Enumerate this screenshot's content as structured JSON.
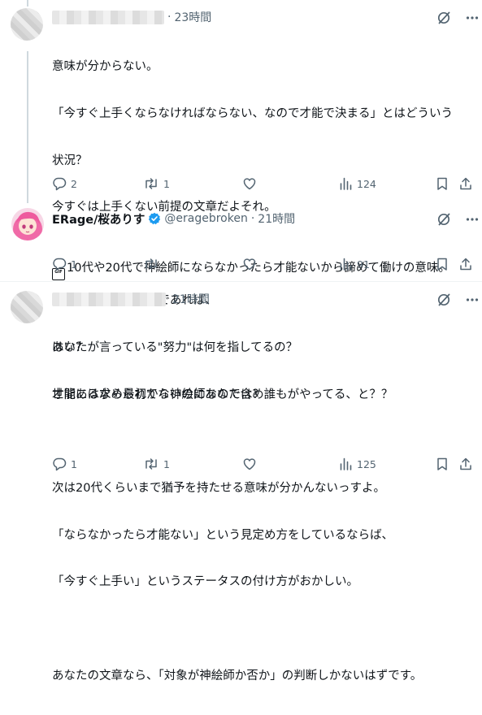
{
  "tweets": [
    {
      "name": "",
      "handle": "",
      "separator": "·",
      "time": "23時間",
      "lines": [
        "意味が分からない。",
        "「今すぐ上手くならなければならない、なので才能で決まる」とはどういう",
        "状況？",
        "今すぐは上手くない前提の文章だよそれ。",
        "",
        "才能があれば済むのであれば、",
        "あなたが言っている\"努力\"は何を指してるの？",
        "世間には求められてないのにあなた含め誰もがやってる、と？？"
      ],
      "replies": "2",
      "reposts": "1",
      "likes": "",
      "views": "124"
    },
    {
      "name": "ERage/桜ありす",
      "handle": "@eragebroken",
      "separator": "·",
      "time": "21時間",
      "gif_label": "GIF",
      "lines": [
        "10代や20代で神絵師にならなかったら才能ないから諦めて働けの意味。"
      ],
      "replies": "1",
      "reposts": "",
      "likes": "",
      "views": "91"
    },
    {
      "name": "",
      "handle": "",
      "separator": "",
      "time": "21時間",
      "lines": [
        "はい？",
        "才能あるなら最初から神絵師なのでは？",
        "",
        "次は20代くらいまで猶予を持たせる意味が分かんないっすよ。",
        "「ならなかったら才能ない」という見定め方をしているならば、",
        "「今すぐ上手い」というステータスの付け方がおかしい。",
        "",
        "あなたの文章なら、「対象が神絵師か否か」の判断しかないはずです。"
      ],
      "replies": "1",
      "reposts": "1",
      "likes": "",
      "views": "125"
    }
  ],
  "icons": {
    "grok": "grok-slash-icon",
    "more": "more-dots-icon",
    "reply": "reply-bubble-icon",
    "repost": "repost-arrows-icon",
    "like": "heart-icon",
    "views": "views-bars-icon",
    "bookmark": "bookmark-icon",
    "share": "share-upload-icon",
    "verified": "verified-badge-icon"
  },
  "colors": {
    "text": "#0f1419",
    "secondary": "#536471",
    "verified": "#1d9bf0",
    "divider": "#eff3f4"
  }
}
